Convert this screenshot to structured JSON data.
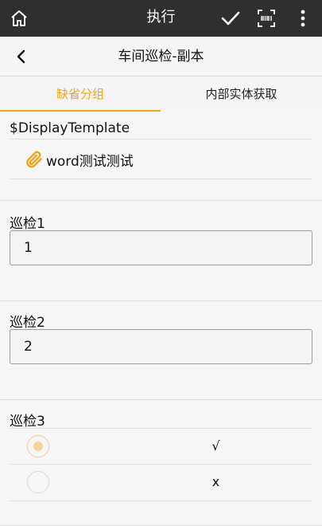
{
  "header": {
    "title": "执行",
    "icons": {
      "home": "home-icon",
      "confirm": "check-icon",
      "scan": "scan-icon",
      "more": "more-vertical-icon"
    }
  },
  "subheader": {
    "title": "车间巡检-副本",
    "back_icon": "chevron-left-icon"
  },
  "tabs": [
    {
      "label": "缺省分组",
      "active": true
    },
    {
      "label": "内部实体获取",
      "active": false
    }
  ],
  "display_section": {
    "label": "$DisplayTemplate",
    "attachment": {
      "icon": "paperclip-icon",
      "name": "word测试测试"
    }
  },
  "fields": [
    {
      "label": "巡检1",
      "value": "1"
    },
    {
      "label": "巡检2",
      "value": "2"
    }
  ],
  "radio_field": {
    "label": "巡检3",
    "options": [
      {
        "label": "√",
        "selected": true
      },
      {
        "label": "x",
        "selected": false
      }
    ]
  },
  "colors": {
    "accent": "#f0a51c",
    "topbar": "#2f2f2f"
  }
}
